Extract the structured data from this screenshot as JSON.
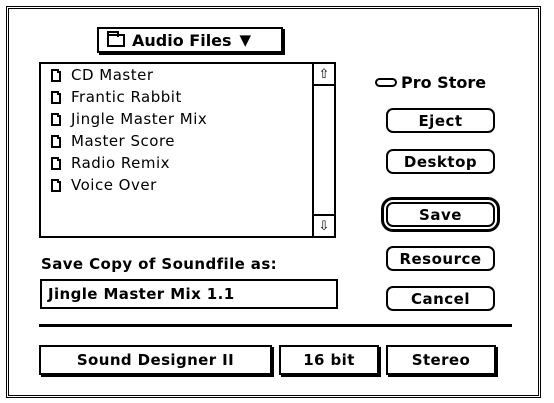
{
  "popup": {
    "label": "Audio Files",
    "arrow": "▼",
    "icon": "folder-icon"
  },
  "files": [
    {
      "name": "CD Master"
    },
    {
      "name": "Frantic Rabbit"
    },
    {
      "name": "Jingle Master Mix"
    },
    {
      "name": "Master Score"
    },
    {
      "name": "Radio Remix"
    },
    {
      "name": "Voice Over"
    }
  ],
  "scroll": {
    "up": "⇧",
    "down": "⇩"
  },
  "disk": {
    "name": "Pro Store",
    "icon": "disk-icon"
  },
  "buttons": {
    "eject": "Eject",
    "desktop": "Desktop",
    "save": "Save",
    "resource": "Resource",
    "cancel": "Cancel"
  },
  "save_prompt": "Save Copy of Soundfile as:",
  "filename_value": "Jingle Master Mix 1.1",
  "format": {
    "type": "Sound Designer II",
    "bits": "16 bit",
    "channels": "Stereo"
  }
}
